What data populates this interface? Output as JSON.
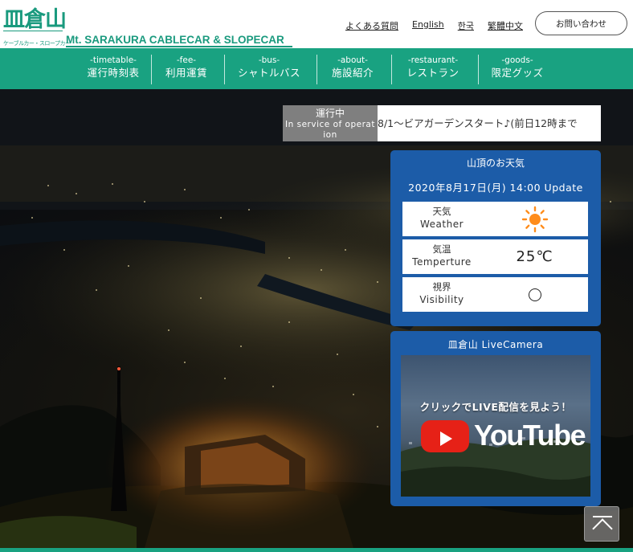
{
  "logo": {
    "kanji": "皿倉山",
    "kana": "ケーブルカー・スロープカー",
    "english": "Mt. SARAKURA CABLECAR & SLOPECAR"
  },
  "top_links": {
    "faq": "よくある質問",
    "english": "English",
    "korean": "한국",
    "traditional_chinese": "繁體中文"
  },
  "contact_button": "お問い合わせ",
  "nav": [
    {
      "en": "-timetable-",
      "jp": "運行時刻表"
    },
    {
      "en": "-fee-",
      "jp": "利用運賃"
    },
    {
      "en": "-bus-",
      "jp": "シャトルバス"
    },
    {
      "en": "-about-",
      "jp": "施設紹介"
    },
    {
      "en": "-restaurant-",
      "jp": "レストラン"
    },
    {
      "en": "-goods-",
      "jp": "限定グッズ"
    }
  ],
  "status": {
    "label_jp": "運行中",
    "label_en_1": "In service of operat",
    "label_en_2": "ion",
    "message": "8/1～ビアガーデンスタート♪(前日12時まで"
  },
  "weather": {
    "title": "山頂のお天気",
    "updated": "2020年8月17日(月) 14:00 Update",
    "rows": [
      {
        "jp": "天気",
        "en": "Weather",
        "value_icon": "sun-icon"
      },
      {
        "jp": "気温",
        "en": "Temperture",
        "value": "25℃"
      },
      {
        "jp": "視界",
        "en": "Visibility",
        "value_icon": "circle-good-icon"
      }
    ]
  },
  "live_camera": {
    "title": "皿倉山 LiveCamera",
    "cta": "クリックでLIVE配信を見よう！",
    "brand": "YouTube"
  },
  "colors": {
    "brand_green": "#19a281",
    "weather_blue": "#1c5ca8",
    "sun_orange": "#ff8c1a",
    "youtube_red": "#e62117"
  }
}
